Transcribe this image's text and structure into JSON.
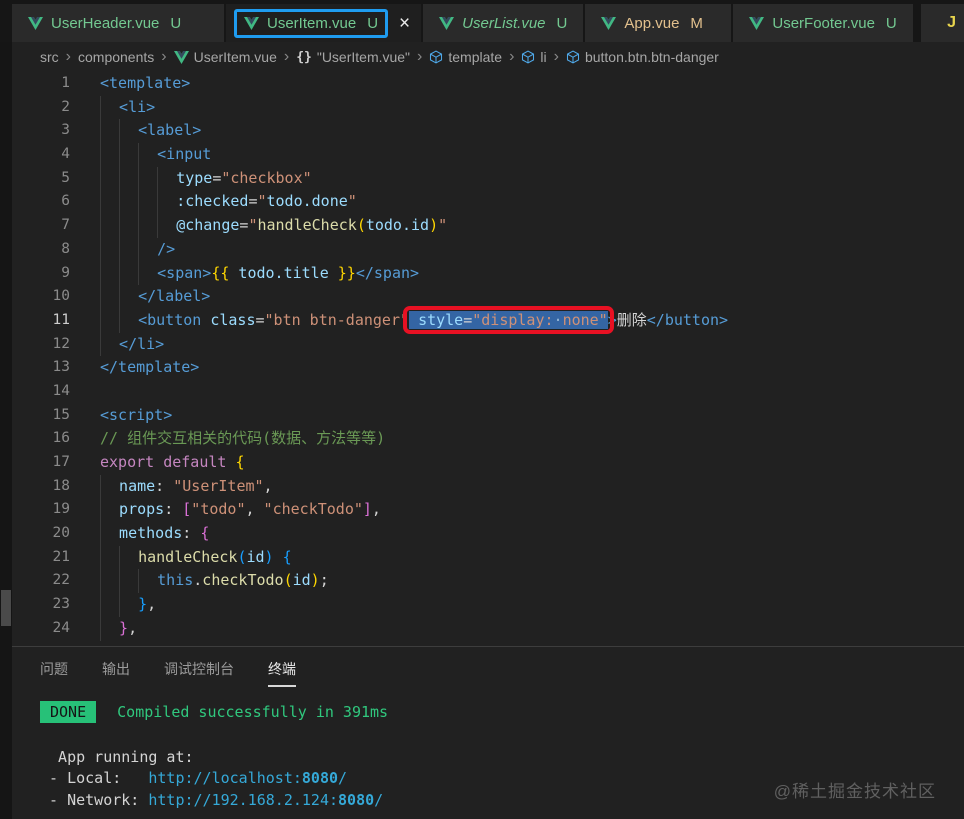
{
  "colors": {
    "accent-blue": "#1f9cf0",
    "annotation-red": "#e81123",
    "selection-blue": "#3465a4",
    "done-green": "#27c178",
    "terminal-green": "#30c87e",
    "url-cyan": "#35a9d8",
    "git-green": "#73c991",
    "git-orange": "#e2c08d",
    "js-yellow": "#e8d44d"
  },
  "tabs": [
    {
      "name": "userheader",
      "label": "UserHeader.vue",
      "badge": "U",
      "icon": "vue",
      "git": "untracked"
    },
    {
      "name": "useritem",
      "label": "UserItem.vue",
      "badge": "U",
      "icon": "vue",
      "git": "untracked",
      "active": true,
      "close_label": "×"
    },
    {
      "name": "userlist",
      "label": "UserList.vue",
      "badge": "U",
      "icon": "vue",
      "git": "untracked",
      "preview": true
    },
    {
      "name": "app",
      "label": "App.vue",
      "badge": "M",
      "icon": "vue",
      "git": "modified"
    },
    {
      "name": "userfooter",
      "label": "UserFooter.vue",
      "badge": "U",
      "icon": "vue",
      "git": "untracked"
    },
    {
      "name": "js-partial",
      "label": "J",
      "icon": "js",
      "git": "js",
      "partial": true
    }
  ],
  "breadcrumb": {
    "separator": "›",
    "items": [
      {
        "label": "src"
      },
      {
        "label": "components"
      },
      {
        "label": "UserItem.vue",
        "icon": "vue"
      },
      {
        "label": "\"UserItem.vue\"",
        "icon": "braces"
      },
      {
        "label": "template",
        "icon": "symbol"
      },
      {
        "label": "li",
        "icon": "symbol"
      },
      {
        "label": "button.btn.btn-danger",
        "icon": "symbol"
      }
    ]
  },
  "editor": {
    "lines": [
      {
        "indent": 0,
        "tokens": [
          {
            "c": "tag",
            "t": "<template>"
          }
        ]
      },
      {
        "indent": 1,
        "tokens": [
          {
            "c": "tag",
            "t": "<li>"
          }
        ]
      },
      {
        "indent": 2,
        "tokens": [
          {
            "c": "tag",
            "t": "<label>"
          }
        ]
      },
      {
        "indent": 3,
        "tokens": [
          {
            "c": "tag",
            "t": "<input"
          }
        ]
      },
      {
        "indent": 4,
        "tokens": [
          {
            "c": "attr",
            "t": "type"
          },
          {
            "c": "tx",
            "t": "="
          },
          {
            "c": "str",
            "t": "\"checkbox\""
          }
        ]
      },
      {
        "indent": 4,
        "tokens": [
          {
            "c": "attr",
            "t": ":checked"
          },
          {
            "c": "tx",
            "t": "="
          },
          {
            "c": "str",
            "t": "\""
          },
          {
            "c": "attr",
            "t": "todo.done"
          },
          {
            "c": "str",
            "t": "\""
          }
        ]
      },
      {
        "indent": 4,
        "tokens": [
          {
            "c": "attr",
            "t": "@change"
          },
          {
            "c": "tx",
            "t": "="
          },
          {
            "c": "str",
            "t": "\""
          },
          {
            "c": "fn",
            "t": "handleCheck"
          },
          {
            "c": "b1",
            "t": "("
          },
          {
            "c": "attr",
            "t": "todo.id"
          },
          {
            "c": "b1",
            "t": ")"
          },
          {
            "c": "str",
            "t": "\""
          }
        ]
      },
      {
        "indent": 3,
        "tokens": [
          {
            "c": "tag",
            "t": "/>"
          }
        ]
      },
      {
        "indent": 3,
        "tokens": [
          {
            "c": "tag",
            "t": "<span>"
          },
          {
            "c": "b1",
            "t": "{{"
          },
          {
            "c": "tx",
            "t": " "
          },
          {
            "c": "attr",
            "t": "todo.title"
          },
          {
            "c": "tx",
            "t": " "
          },
          {
            "c": "b1",
            "t": "}}"
          },
          {
            "c": "tag",
            "t": "</span>"
          }
        ]
      },
      {
        "indent": 2,
        "tokens": [
          {
            "c": "tag",
            "t": "</label>"
          }
        ]
      },
      {
        "indent": 2,
        "active": true,
        "tokens": [
          {
            "c": "tag",
            "t": "<button"
          },
          {
            "c": "tx",
            "t": " "
          },
          {
            "c": "attr",
            "t": "class"
          },
          {
            "c": "tx",
            "t": "="
          },
          {
            "c": "str",
            "t": "\"btn btn-danger\""
          },
          {
            "c": "tx",
            "t": " ",
            "sel": true
          },
          {
            "c": "attr",
            "t": "style",
            "sel": true
          },
          {
            "c": "tx",
            "t": "=",
            "sel": true
          },
          {
            "c": "str",
            "t": "\"display:",
            "sel": true
          },
          {
            "c": "wsd",
            "t": "·",
            "sel": true
          },
          {
            "c": "str",
            "t": "none\"",
            "sel": true
          },
          {
            "c": "tag",
            "t": ">"
          },
          {
            "c": "tx",
            "t": "删除"
          },
          {
            "c": "tag",
            "t": "</button>"
          }
        ]
      },
      {
        "indent": 1,
        "tokens": [
          {
            "c": "tag",
            "t": "</li>"
          }
        ]
      },
      {
        "indent": 0,
        "tokens": [
          {
            "c": "tag",
            "t": "</template>"
          }
        ]
      },
      {
        "indent": 0,
        "tokens": []
      },
      {
        "indent": 0,
        "tokens": [
          {
            "c": "tag",
            "t": "<script>"
          }
        ]
      },
      {
        "indent": 0,
        "tokens": [
          {
            "c": "cm",
            "t": "// 组件交互相关的代码(数据、方法等等)"
          }
        ]
      },
      {
        "indent": 0,
        "tokens": [
          {
            "c": "kw",
            "t": "export"
          },
          {
            "c": "tx",
            "t": " "
          },
          {
            "c": "kw",
            "t": "default"
          },
          {
            "c": "tx",
            "t": " "
          },
          {
            "c": "b1",
            "t": "{"
          }
        ]
      },
      {
        "indent": 1,
        "tokens": [
          {
            "c": "attr",
            "t": "name"
          },
          {
            "c": "tx",
            "t": ": "
          },
          {
            "c": "str",
            "t": "\"UserItem\""
          },
          {
            "c": "tx",
            "t": ","
          }
        ]
      },
      {
        "indent": 1,
        "tokens": [
          {
            "c": "attr",
            "t": "props"
          },
          {
            "c": "tx",
            "t": ": "
          },
          {
            "c": "b2",
            "t": "["
          },
          {
            "c": "str",
            "t": "\"todo\""
          },
          {
            "c": "tx",
            "t": ", "
          },
          {
            "c": "str",
            "t": "\"checkTodo\""
          },
          {
            "c": "b2",
            "t": "]"
          },
          {
            "c": "tx",
            "t": ","
          }
        ]
      },
      {
        "indent": 1,
        "tokens": [
          {
            "c": "attr",
            "t": "methods"
          },
          {
            "c": "tx",
            "t": ": "
          },
          {
            "c": "b2",
            "t": "{"
          }
        ]
      },
      {
        "indent": 2,
        "tokens": [
          {
            "c": "fn",
            "t": "handleCheck"
          },
          {
            "c": "b3",
            "t": "("
          },
          {
            "c": "attr",
            "t": "id"
          },
          {
            "c": "b3",
            "t": ")"
          },
          {
            "c": "tx",
            "t": " "
          },
          {
            "c": "b3",
            "t": "{"
          }
        ]
      },
      {
        "indent": 3,
        "tokens": [
          {
            "c": "tag",
            "t": "this"
          },
          {
            "c": "tx",
            "t": "."
          },
          {
            "c": "fn",
            "t": "checkTodo"
          },
          {
            "c": "b1",
            "t": "("
          },
          {
            "c": "attr",
            "t": "id"
          },
          {
            "c": "b1",
            "t": ")"
          },
          {
            "c": "tx",
            "t": ";"
          }
        ]
      },
      {
        "indent": 2,
        "tokens": [
          {
            "c": "b3",
            "t": "}"
          },
          {
            "c": "tx",
            "t": ","
          }
        ]
      },
      {
        "indent": 1,
        "tokens": [
          {
            "c": "b2",
            "t": "}"
          },
          {
            "c": "tx",
            "t": ","
          }
        ]
      }
    ]
  },
  "panel": {
    "tabs": [
      {
        "name": "problems",
        "label": "问题"
      },
      {
        "name": "output",
        "label": "输出"
      },
      {
        "name": "debug-console",
        "label": "调试控制台"
      },
      {
        "name": "terminal",
        "label": "终端",
        "active": true
      }
    ]
  },
  "terminal": {
    "done_badge": "DONE",
    "done_message": "Compiled successfully in 391ms",
    "lines": [
      {
        "text": "  App running at:"
      },
      {
        "text": " - Local:   ",
        "url": {
          "prefix": "http://localhost:",
          "port": "8080",
          "suffix": "/"
        }
      },
      {
        "text": " - Network: ",
        "url": {
          "prefix": "http://192.168.2.124:",
          "port": "8080",
          "suffix": "/"
        }
      }
    ]
  },
  "watermark": "@稀土掘金技术社区"
}
